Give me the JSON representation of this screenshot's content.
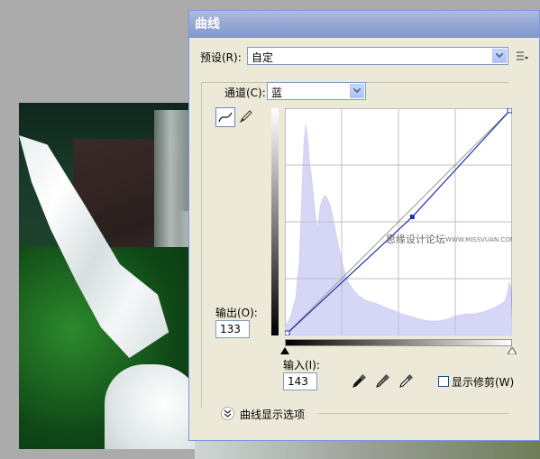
{
  "dialog": {
    "title": "曲线",
    "preset_label": "预设(R):",
    "preset_value": "自定",
    "channel_label": "通道(C):",
    "channel_value": "蓝",
    "output_label": "输出(O):",
    "output_value": "133",
    "input_label": "输入(I):",
    "input_value": "143",
    "show_clipping_label": "显示修剪(W)",
    "show_clipping_checked": false,
    "curve_options_label": "曲线显示选项",
    "curve_point": {
      "input": 143,
      "output": 133
    }
  },
  "watermark": {
    "main": "思缘设计论坛",
    "url": "WWW.MISSVUAN.COM"
  },
  "icons": {
    "preset_menu": "preset-menu-icon",
    "curve_tool": "curve-tool-icon",
    "pencil_tool": "pencil-icon",
    "black_eyedropper": "black-point-eyedropper-icon",
    "gray_eyedropper": "gray-point-eyedropper-icon",
    "white_eyedropper": "white-point-eyedropper-icon",
    "expand": "chevron-double-down-icon"
  },
  "colors": {
    "histogram": "#d6d7f7",
    "curve": "#1f2fa8",
    "titlebar": "#8fa4d2"
  }
}
